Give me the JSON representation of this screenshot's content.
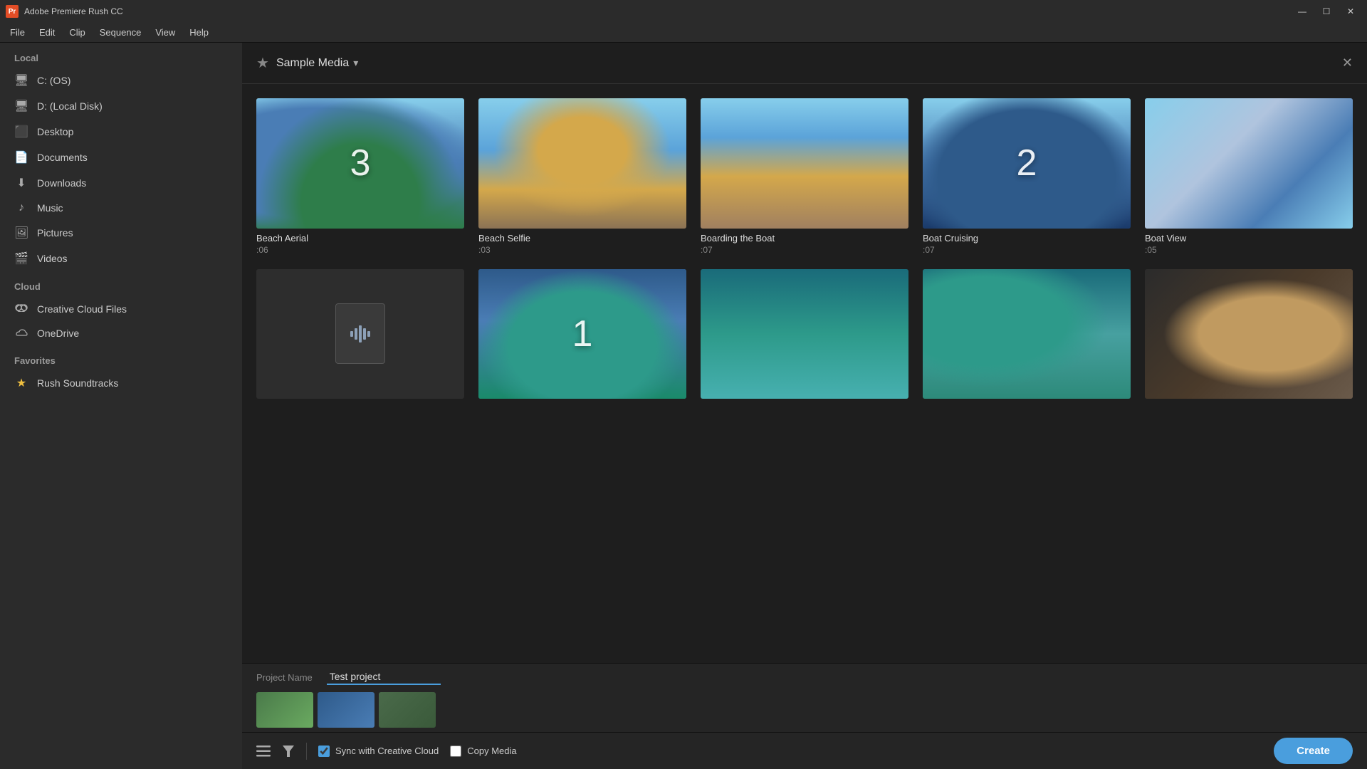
{
  "app": {
    "title": "Adobe Premiere Rush CC",
    "icon_label": "Pr"
  },
  "titlebar": {
    "minimize": "—",
    "maximize": "☐",
    "close": "✕"
  },
  "menubar": {
    "items": [
      "File",
      "Edit",
      "Clip",
      "Sequence",
      "View",
      "Help"
    ]
  },
  "sidebar": {
    "local_label": "Local",
    "local_items": [
      {
        "icon": "💻",
        "label": "C: (OS)",
        "name": "c-os"
      },
      {
        "icon": "💻",
        "label": "D: (Local Disk)",
        "name": "d-local"
      },
      {
        "icon": "🖥",
        "label": "Desktop",
        "name": "desktop"
      },
      {
        "icon": "📄",
        "label": "Documents",
        "name": "documents"
      },
      {
        "icon": "⬇",
        "label": "Downloads",
        "name": "downloads"
      },
      {
        "icon": "♪",
        "label": "Music",
        "name": "music"
      },
      {
        "icon": "🖼",
        "label": "Pictures",
        "name": "pictures"
      },
      {
        "icon": "🎬",
        "label": "Videos",
        "name": "videos"
      }
    ],
    "cloud_label": "Cloud",
    "cloud_items": [
      {
        "icon": "☁",
        "label": "Creative Cloud Files",
        "name": "creative-cloud"
      },
      {
        "icon": "☁",
        "label": "OneDrive",
        "name": "onedrive"
      }
    ],
    "favorites_label": "Favorites",
    "favorites_items": [
      {
        "icon": "★",
        "label": "Rush Soundtracks",
        "name": "rush-soundtracks"
      }
    ]
  },
  "media_browser": {
    "star_icon": "★",
    "title": "Sample Media",
    "dropdown_arrow": "▾",
    "close_label": "✕",
    "items": [
      {
        "id": "beach-aerial",
        "title": "Beach Aerial",
        "duration": ":06",
        "stack_num": "3",
        "has_stack": true
      },
      {
        "id": "beach-selfie",
        "title": "Beach Selfie",
        "duration": ":03",
        "has_stack": false
      },
      {
        "id": "boarding-boat",
        "title": "Boarding the Boat",
        "duration": ":07",
        "has_stack": false
      },
      {
        "id": "boat-cruising",
        "title": "Boat Cruising",
        "duration": ":07",
        "stack_num": "2",
        "has_stack": true
      },
      {
        "id": "boat-view",
        "title": "Boat View",
        "duration": ":05",
        "has_stack": false
      },
      {
        "id": "audio-file",
        "title": "",
        "duration": "",
        "is_audio": true,
        "has_stack": false
      },
      {
        "id": "boat-island",
        "title": "",
        "duration": "",
        "stack_num": "1",
        "has_stack": true
      },
      {
        "id": "underwater",
        "title": "",
        "duration": "",
        "has_stack": false
      },
      {
        "id": "boat-sailing",
        "title": "",
        "duration": "",
        "has_stack": false
      },
      {
        "id": "selfie-outdoor",
        "title": "",
        "duration": "",
        "has_stack": false
      }
    ]
  },
  "project": {
    "name_label": "Project Name",
    "name_value": "Test project",
    "name_placeholder": "Test project"
  },
  "footer": {
    "sync_label": "Sync with Creative Cloud",
    "sync_checked": true,
    "copy_label": "Copy Media",
    "copy_checked": false,
    "create_label": "Create"
  }
}
